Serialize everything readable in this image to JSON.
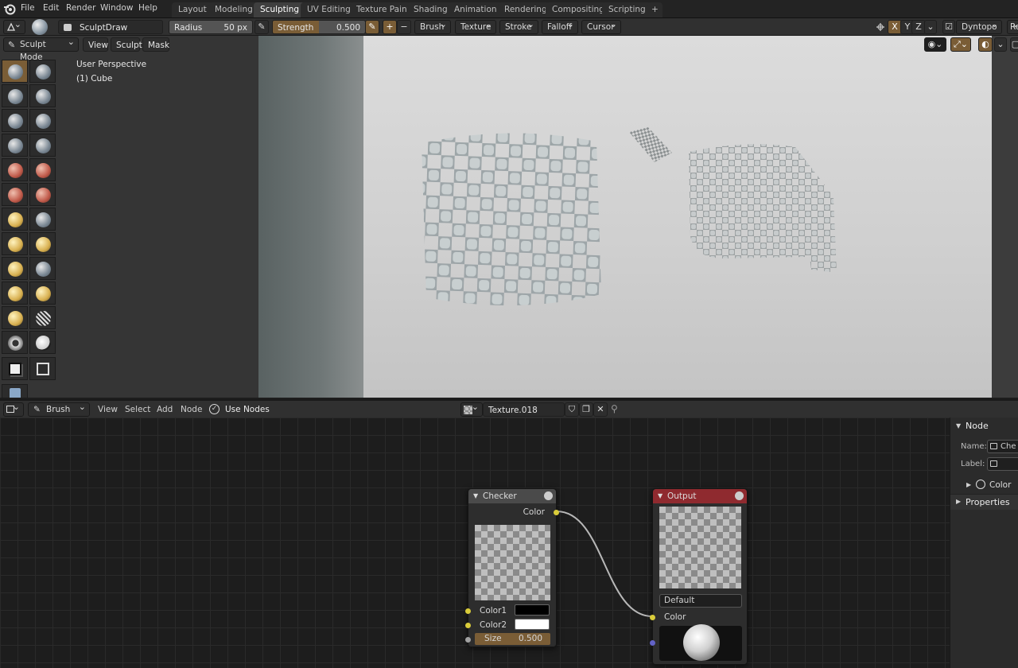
{
  "menubar": {
    "items": [
      "File",
      "Edit",
      "Render",
      "Window",
      "Help"
    ],
    "tabs": [
      "Layout",
      "Modeling",
      "Sculpting",
      "UV Editing",
      "Texture Paint",
      "Shading",
      "Animation",
      "Rendering",
      "Compositing",
      "Scripting"
    ],
    "active_tab": "Sculpting",
    "add_tab": "+"
  },
  "tool_header": {
    "brush_name": "SculptDraw",
    "radius_label": "Radius",
    "radius_value": "50 px",
    "strength_label": "Strength",
    "strength_value": "0.500",
    "plus": "+",
    "minus": "−",
    "menus": [
      "Brush",
      "Texture",
      "Stroke",
      "Falloff",
      "Cursor"
    ],
    "axes": [
      "X",
      "Y",
      "Z"
    ],
    "dyntopo": "Dyntopo",
    "cut_right": "Re"
  },
  "viewport": {
    "mode": "Sculpt Mode",
    "menus": [
      "View",
      "Sculpt",
      "Mask"
    ],
    "perspective": "User Perspective",
    "object": "(1) Cube"
  },
  "node_editor": {
    "type": "Brush",
    "menus": [
      "View",
      "Select",
      "Add",
      "Node"
    ],
    "use_nodes": "Use Nodes",
    "texture_name": "Texture.018"
  },
  "checker_node": {
    "title": "Checker",
    "output": "Color",
    "color1": "Color1",
    "color2": "Color2",
    "size_label": "Size",
    "size_value": "0.500"
  },
  "output_node": {
    "title": "Output",
    "name_field": "Default",
    "input": "Color"
  },
  "side_panel": {
    "section": "Node",
    "name_label": "Name:",
    "name_value": "Che",
    "label_label": "Label:",
    "color_label": "Color",
    "properties_label": "Properties"
  },
  "colors": {
    "accent": "#7a5d36",
    "socket_yellow": "#d9cc3a",
    "socket_gray": "#a1a1a1",
    "socket_purple": "#6363c7",
    "output_header": "#8f2a2f",
    "checker_header": "#4a4a4a"
  },
  "icons": [
    "blender-logo-icon",
    "brush-icon",
    "pen-icon",
    "mirror-icon",
    "checkbox-icon",
    "texture-icon",
    "shield-icon",
    "copy-icon",
    "close-icon",
    "pin-icon",
    "node-editor-icon",
    "sphere-icon"
  ]
}
